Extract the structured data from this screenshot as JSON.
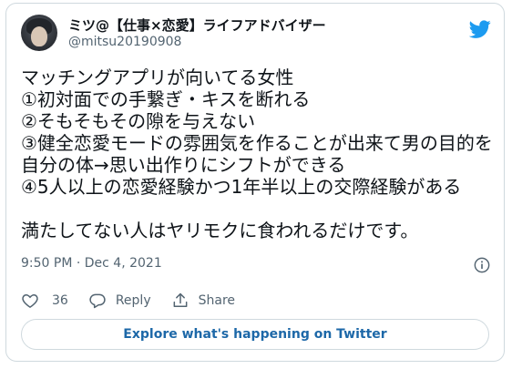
{
  "tweet": {
    "author_name": "ミツ@【仕事×恋愛】ライフアドバイザー",
    "author_handle": "@mitsu20190908",
    "text": "マッチングアプリが向いてる女性\n①初対面での手繋ぎ・キスを断れる\n②そもそもその隙を与えない\n③健全恋愛モードの雰囲気を作ることが出来て男の目的を自分の体→思い出作りにシフトができる\n④5人以上の恋愛経験かつ1年半以上の交際経験がある\n\n満たしてない人はヤリモクに食われるだけです。",
    "timestamp": "9:50 PM · Dec 4, 2021",
    "likes": "36",
    "reply_label": "Reply",
    "share_label": "Share",
    "explore_label": "Explore what's happening on Twitter"
  },
  "icons": {
    "avatar": "avatar",
    "brand": "twitter-bird-icon",
    "info": "info-icon",
    "like": "heart-icon",
    "reply": "reply-icon",
    "share": "share-icon"
  },
  "colors": {
    "brand_blue": "#1d9bf0",
    "text_secondary": "#536471",
    "link_blue": "#1d68a8",
    "border": "#cfd9de"
  }
}
